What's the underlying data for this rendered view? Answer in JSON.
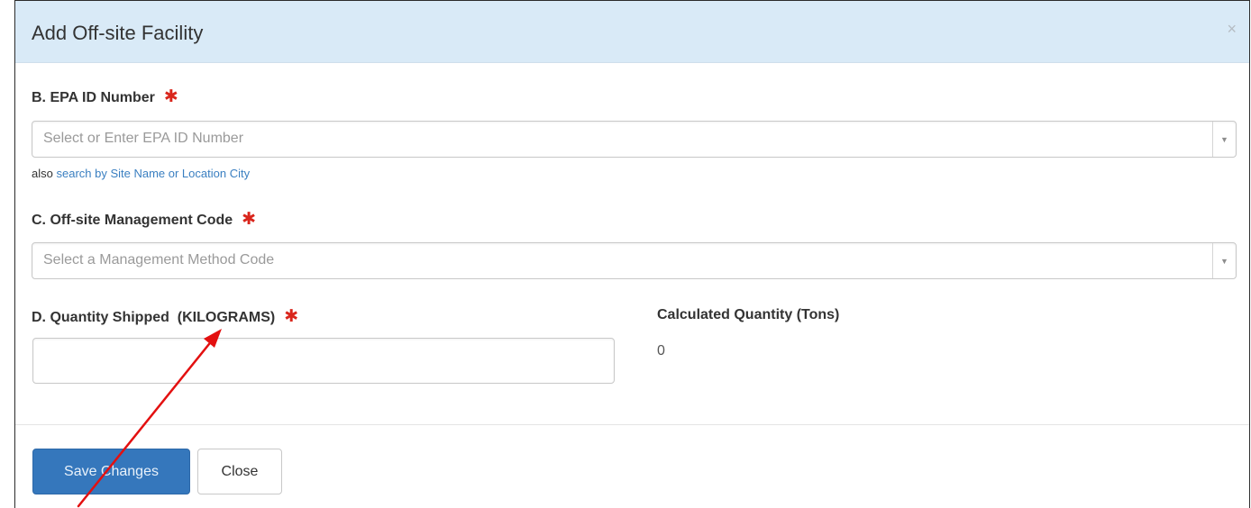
{
  "modal": {
    "title": "Add Off-site Facility",
    "close_symbol": "×"
  },
  "epa_id": {
    "label": "B. EPA ID Number",
    "required_mark": "✱",
    "placeholder": "Select or Enter EPA ID Number",
    "dropdown_arrow": "▼",
    "helper_prefix": "also",
    "helper_link": "search by Site Name or Location City"
  },
  "mgmt_code": {
    "label": "C. Off-site Management Code",
    "required_mark": "✱",
    "placeholder": "Select a Management Method Code",
    "dropdown_arrow": "▼"
  },
  "quantity": {
    "label": "D. Quantity Shipped  (KILOGRAMS)",
    "required_mark": "✱",
    "value": ""
  },
  "calculated": {
    "label": "Calculated Quantity (Tons)",
    "value": "0"
  },
  "footer": {
    "save_label": "Save Changes",
    "close_label": "Close"
  },
  "colors": {
    "header_bg": "#d9eaf7",
    "required": "#d9261c",
    "primary_button": "#3577bc",
    "link": "#3a7fc1",
    "annotation_arrow": "#e31010"
  },
  "annotation": {
    "type": "red-arrow",
    "points_to": "quantity-label-unit"
  }
}
